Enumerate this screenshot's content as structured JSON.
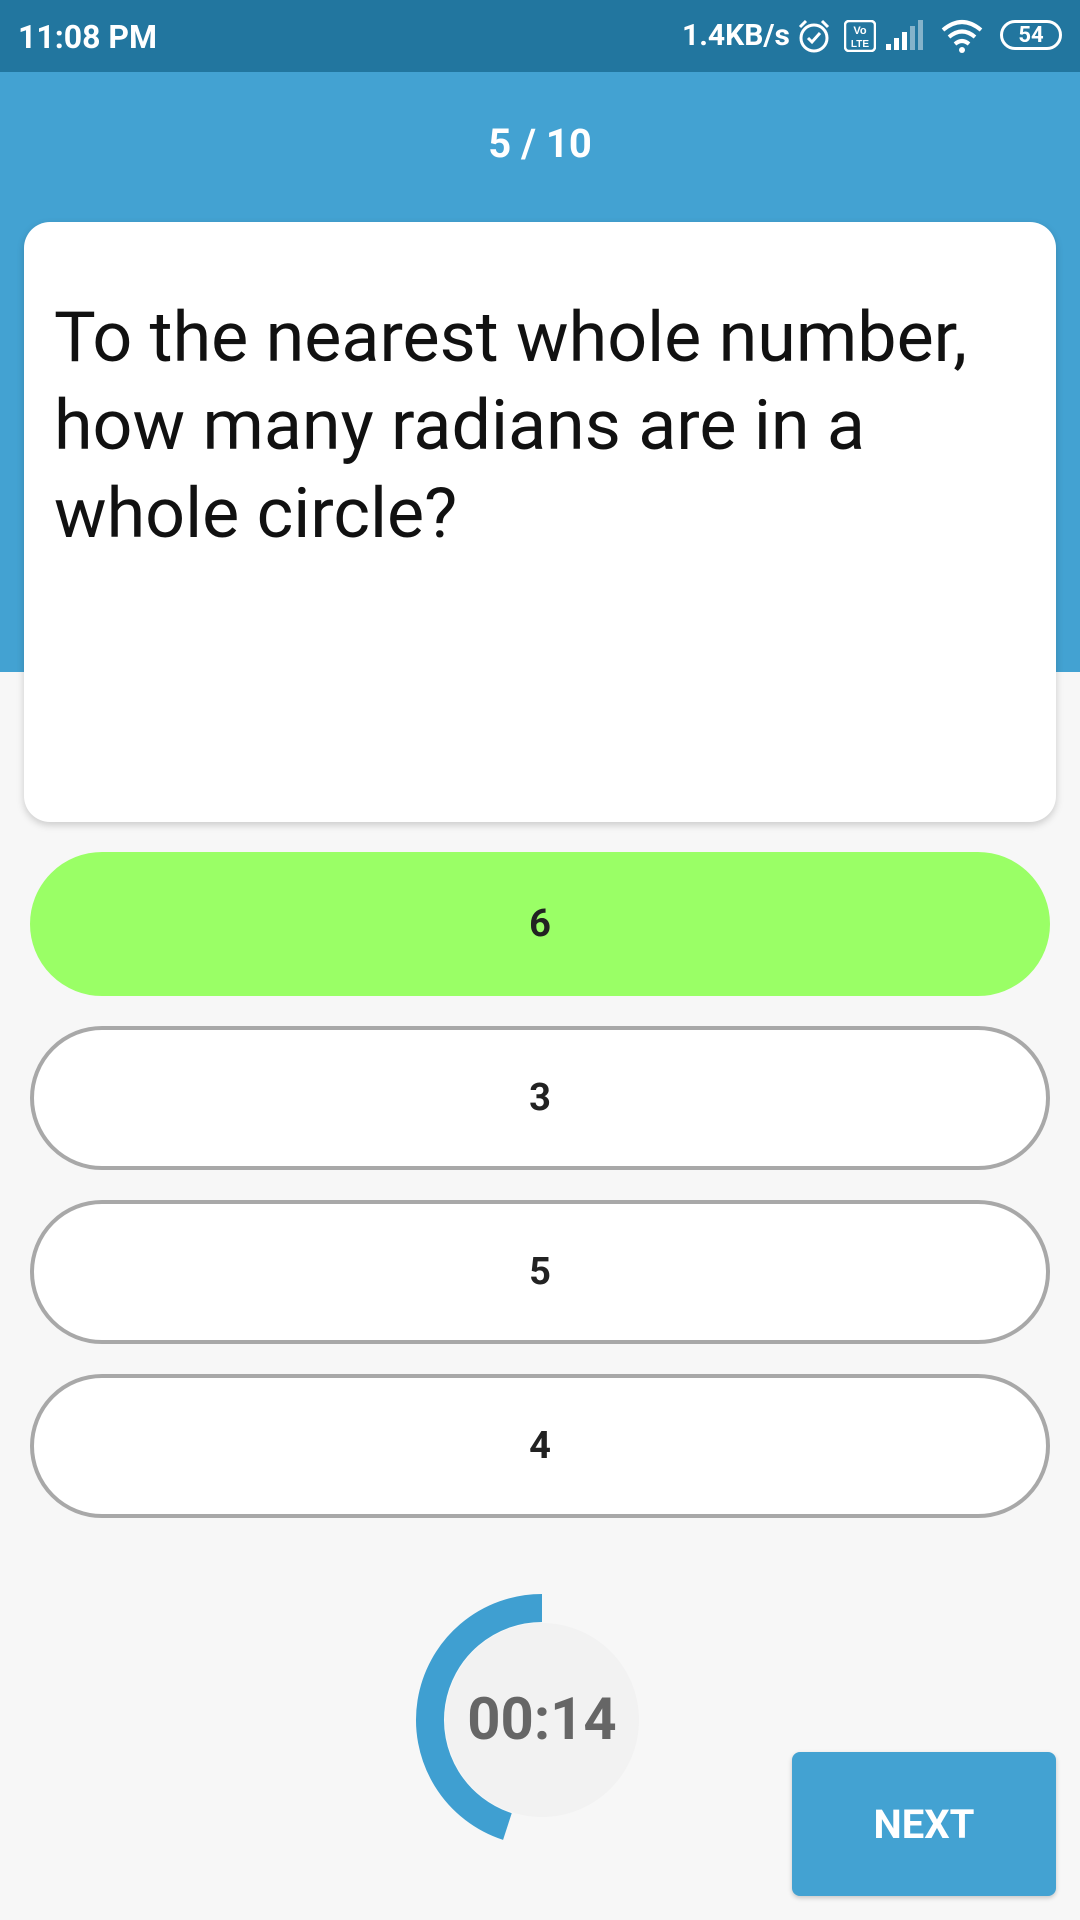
{
  "status_bar": {
    "time": "11:08 PM",
    "network_speed": "1.4KB/s",
    "battery": "54",
    "icons": [
      "alarm-icon",
      "volte-icon",
      "signal-icon",
      "wifi-icon",
      "battery-icon"
    ]
  },
  "quiz": {
    "progress": "5 / 10",
    "question": "To the nearest whole number, how many radians are in a whole circle?",
    "options": [
      {
        "label": "6",
        "selected": true
      },
      {
        "label": "3",
        "selected": false
      },
      {
        "label": "5",
        "selected": false
      },
      {
        "label": "4",
        "selected": false
      }
    ],
    "timer": "00:14",
    "timer_progress_fraction": 0.45,
    "next_label": "NEXT"
  },
  "colors": {
    "status_bar": "#22769f",
    "header": "#43a2d2",
    "selected_option": "#9aff66",
    "option_border": "#a8a8a8",
    "timer_ring": "#3f9fd1"
  }
}
